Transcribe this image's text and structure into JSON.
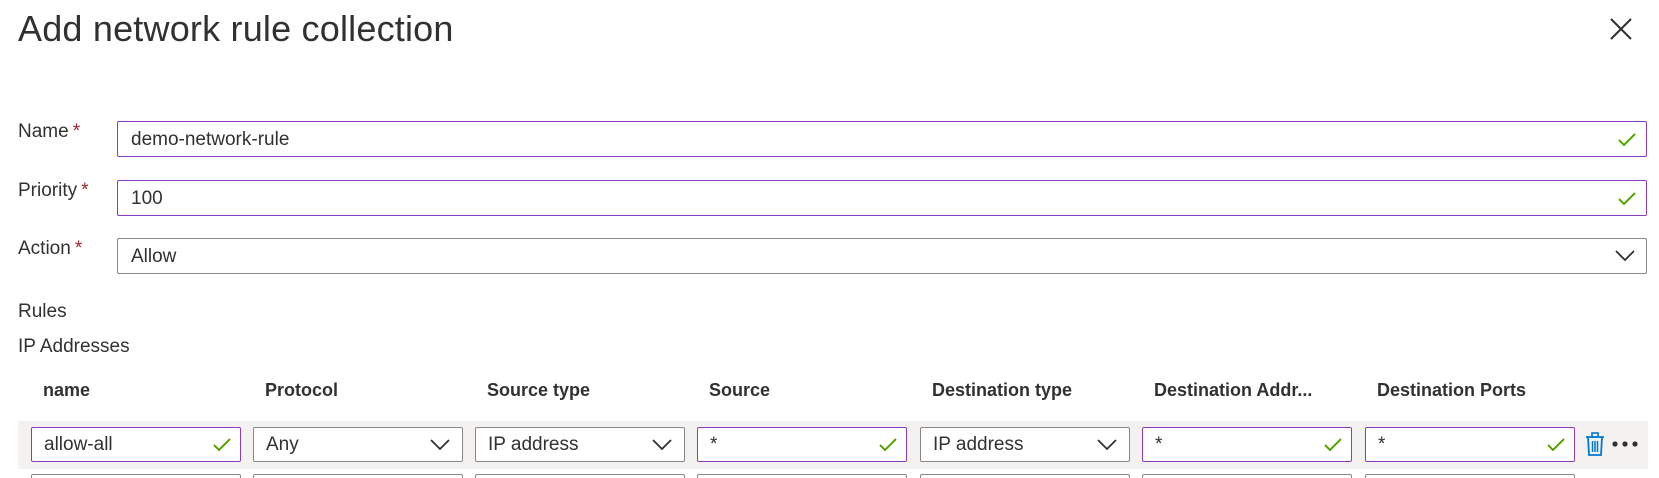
{
  "panel": {
    "title": "Add network rule collection",
    "close_icon": "close-icon"
  },
  "form": {
    "name": {
      "label": "Name",
      "required": "*",
      "value": "demo-network-rule",
      "valid": true
    },
    "priority": {
      "label": "Priority",
      "required": "*",
      "value": "100",
      "valid": true
    },
    "action": {
      "label": "Action",
      "required": "*",
      "value": "Allow"
    }
  },
  "rules": {
    "section_label": "Rules",
    "subsection_label": "IP Addresses",
    "columns": [
      "name",
      "Protocol",
      "Source type",
      "Source",
      "Destination type",
      "Destination Addr...",
      "Destination Ports"
    ],
    "rows": [
      {
        "name": "allow-all",
        "protocol": "Any",
        "source_type": "IP address",
        "source": "*",
        "destination_type": "IP address",
        "destination_address": "*",
        "destination_ports": "*"
      }
    ]
  },
  "colors": {
    "valid_border": "#8a3bbf",
    "check": "#57a300",
    "required": "#a4262c",
    "delete_icon": "#0078d4",
    "row_band": "#f3f2f1"
  },
  "icons": {
    "valid": "checkmark-icon",
    "dropdown": "chevron-down-icon",
    "delete": "trash-icon",
    "more": "more-options-icon"
  }
}
